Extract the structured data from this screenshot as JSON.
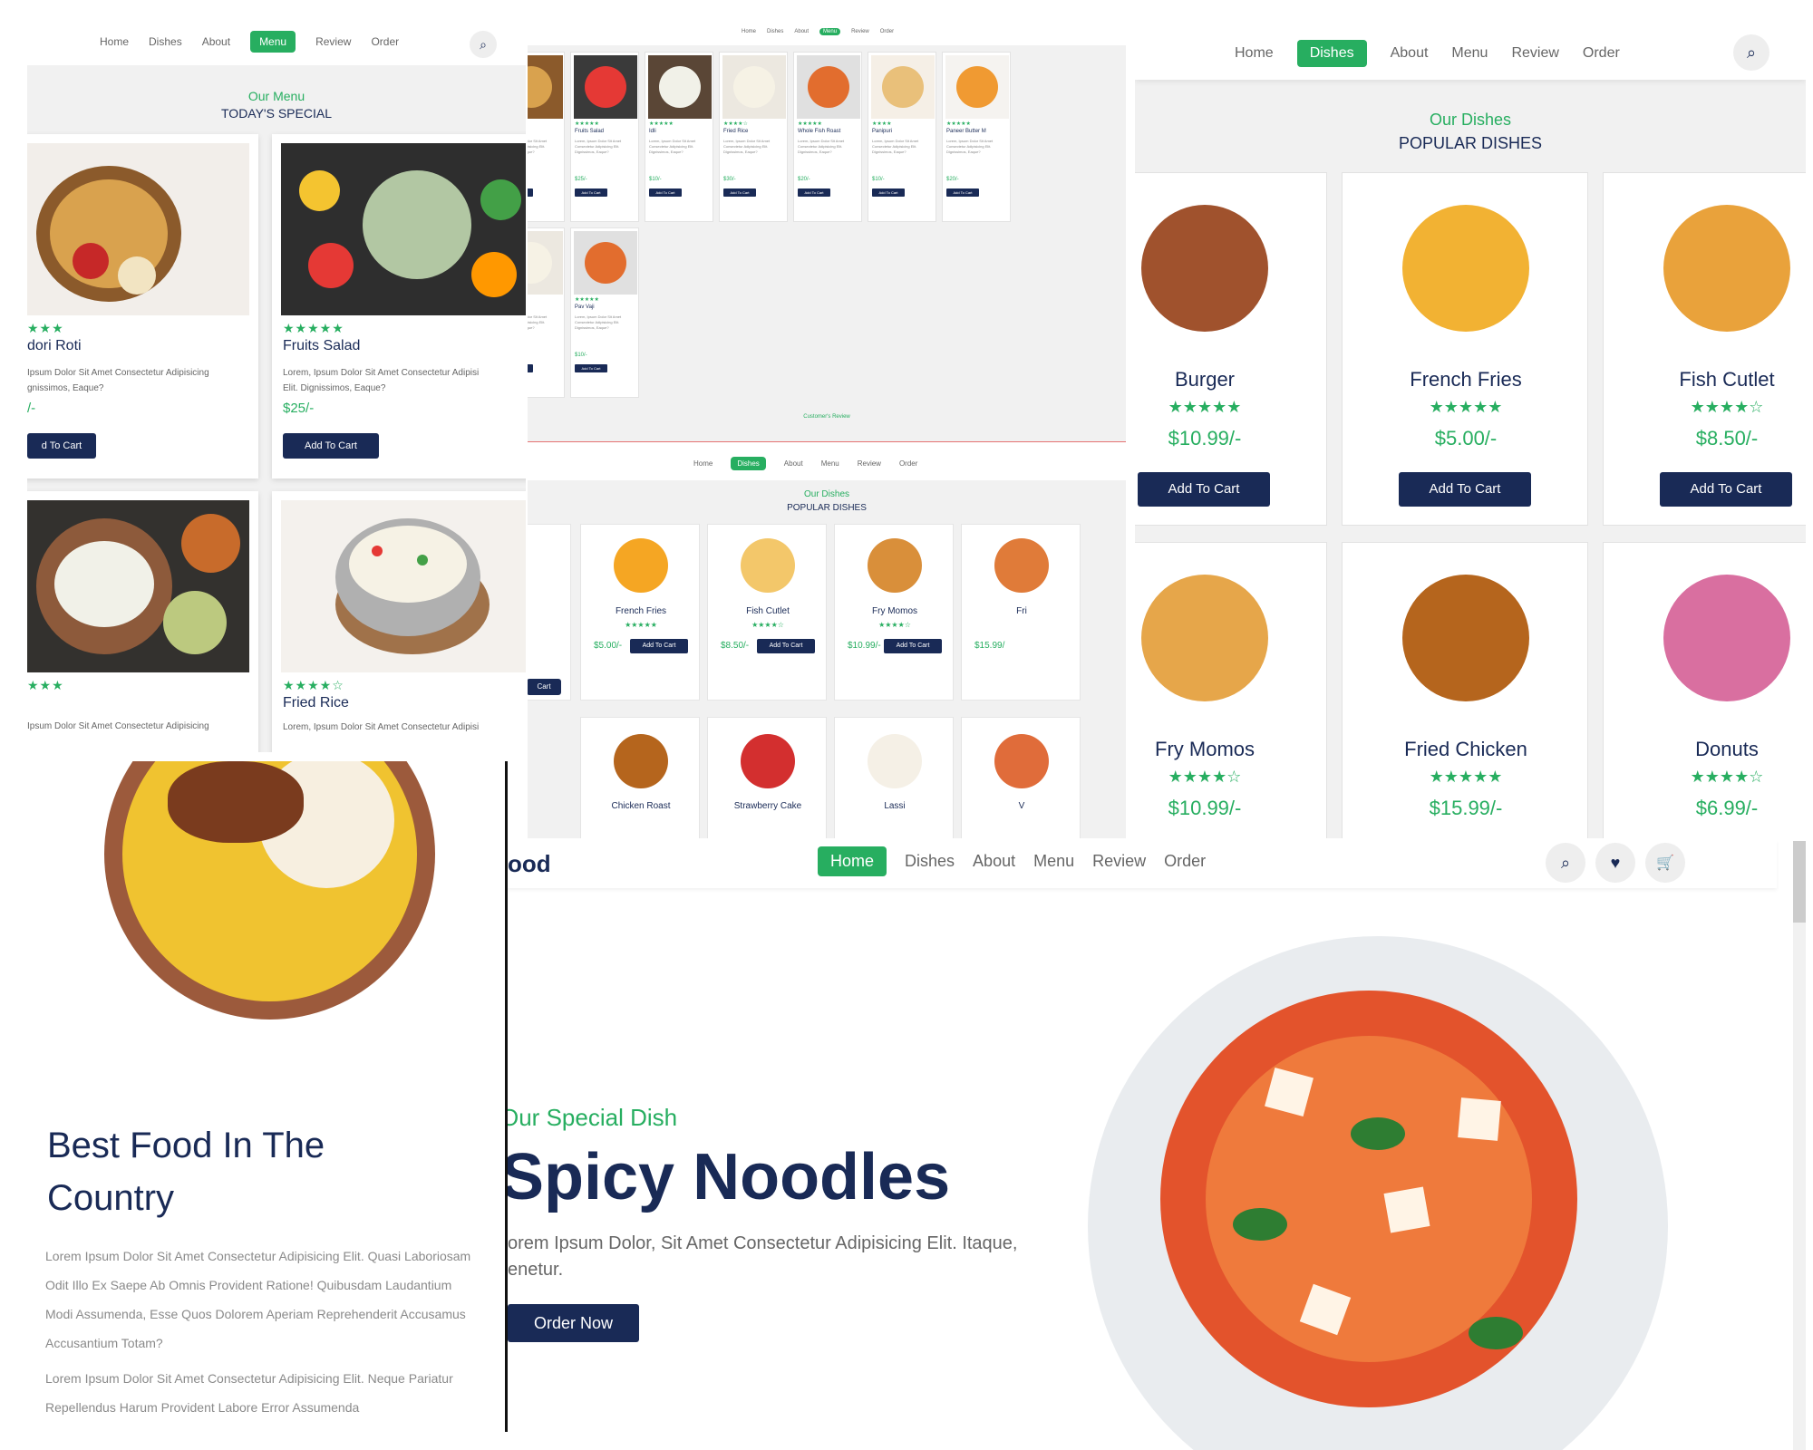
{
  "nav": {
    "links": [
      "Home",
      "Dishes",
      "About",
      "Menu",
      "Review",
      "Order"
    ],
    "logo_fragment": "ood"
  },
  "menu_panel": {
    "subtitle": "Our Menu",
    "title": "TODAY'S SPECIAL",
    "items": [
      {
        "name": "dori Roti",
        "stars": "★★★",
        "desc": "Ipsum Dolor Sit Amet Consectetur Adipisicing\ngnissimos, Eaque?",
        "price": "/-",
        "button": "d To Cart"
      },
      {
        "name": "Fruits Salad",
        "stars": "★★★★★",
        "desc": "Lorem, Ipsum Dolor Sit Amet Consectetur Adipisi\nElit. Dignissimos, Eaque?",
        "price": "$25/-",
        "button": "Add To Cart"
      },
      {
        "name": "",
        "stars": "★★★",
        "desc": "Ipsum Dolor Sit Amet Consectetur Adipisicing",
        "price": "",
        "button": ""
      },
      {
        "name": "Fried Rice",
        "stars": "★★★★☆",
        "desc": "Lorem, Ipsum Dolor Sit Amet Consectetur Adipisi",
        "price": "",
        "button": ""
      }
    ]
  },
  "mini_menu": {
    "items": [
      {
        "name": "ti",
        "stars": "",
        "price": ""
      },
      {
        "name": "Fruits Salad",
        "stars": "★★★★★",
        "price": "$25/-"
      },
      {
        "name": "Idli",
        "stars": "★★★★★",
        "price": "$10/-"
      },
      {
        "name": "Fried Rice",
        "stars": "★★★★☆",
        "price": "$30/-"
      },
      {
        "name": "Whole Fish Roast",
        "stars": "★★★★★",
        "price": "$20/-"
      },
      {
        "name": "Panipuri",
        "stars": "★★★★",
        "price": "$10/-"
      },
      {
        "name": "Paneer Butter M",
        "stars": "★★★★★",
        "price": "$20/-"
      }
    ],
    "row2": [
      {
        "name": "sta",
        "stars": "",
        "price": ""
      },
      {
        "name": "Pav Vaji",
        "stars": "★★★★★",
        "price": "$10/-"
      }
    ],
    "mini_desc": "Lorem, Ipsum Dolor Sit Amet Consectetur Adipisicing Elit. Dignissimos, Eaque?",
    "mini_button": "Add To Cart",
    "review_label": "Customer's Review"
  },
  "mini_dishes": {
    "subtitle": "Our Dishes",
    "title": "POPULAR DISHES",
    "items": [
      {
        "name": "French Fries",
        "stars": "★★★★★",
        "price": "$5.00/-",
        "button": "Add To Cart"
      },
      {
        "name": "Fish Cutlet",
        "stars": "★★★★☆",
        "price": "$8.50/-",
        "button": "Add To Cart"
      },
      {
        "name": "Fry Momos",
        "stars": "★★★★☆",
        "price": "$10.99/-",
        "button": "Add To Cart"
      },
      {
        "name": "Fri",
        "stars": "",
        "price": "$15.99/",
        "button": ""
      }
    ],
    "row2": [
      "Chicken Roast",
      "Strawberry Cake",
      "Lassi",
      "V"
    ],
    "left_button_fragment": "Cart"
  },
  "dishes_panel": {
    "subtitle": "Our Dishes",
    "title": "POPULAR DISHES",
    "items": [
      {
        "name": "Burger",
        "stars": "★★★★★",
        "price": "$10.99/-",
        "button": "Add To Cart"
      },
      {
        "name": "French Fries",
        "stars": "★★★★★",
        "price": "$5.00/-",
        "button": "Add To Cart"
      },
      {
        "name": "Fish Cutlet",
        "stars": "★★★★☆",
        "price": "$8.50/-",
        "button": "Add To Cart"
      },
      {
        "name": "Fry Momos",
        "stars": "★★★★☆",
        "price": "$10.99/-",
        "button": ""
      },
      {
        "name": "Fried Chicken",
        "stars": "★★★★★",
        "price": "$15.99/-",
        "button": ""
      },
      {
        "name": "Donuts",
        "stars": "★★★★☆",
        "price": "$6.99/-",
        "button": ""
      }
    ]
  },
  "about_panel": {
    "heading": "Best Food In The Country",
    "para1": "Lorem Ipsum Dolor Sit Amet Consectetur Adipisicing Elit. Quasi Laboriosam Odit Illo Ex Saepe Ab Omnis Provident Ratione! Quibusdam Laudantium Modi Assumenda, Esse Quos Dolorem Aperiam Reprehenderit Accusamus Accusantium Totam?",
    "para2": "Lorem Ipsum Dolor Sit Amet Consectetur Adipisicing Elit. Neque Pariatur Repellendus Harum Provident Labore Error Assumenda"
  },
  "hero": {
    "subtitle": "Our Special Dish",
    "title": "Spicy Noodles",
    "text": "orem Ipsum Dolor, Sit Amet Consectetur Adipisicing Elit. Itaque,\nenetur.",
    "button": "Order Now"
  },
  "colors": {
    "green": "#27ae60",
    "navy": "#192a56",
    "gray": "#666666"
  }
}
